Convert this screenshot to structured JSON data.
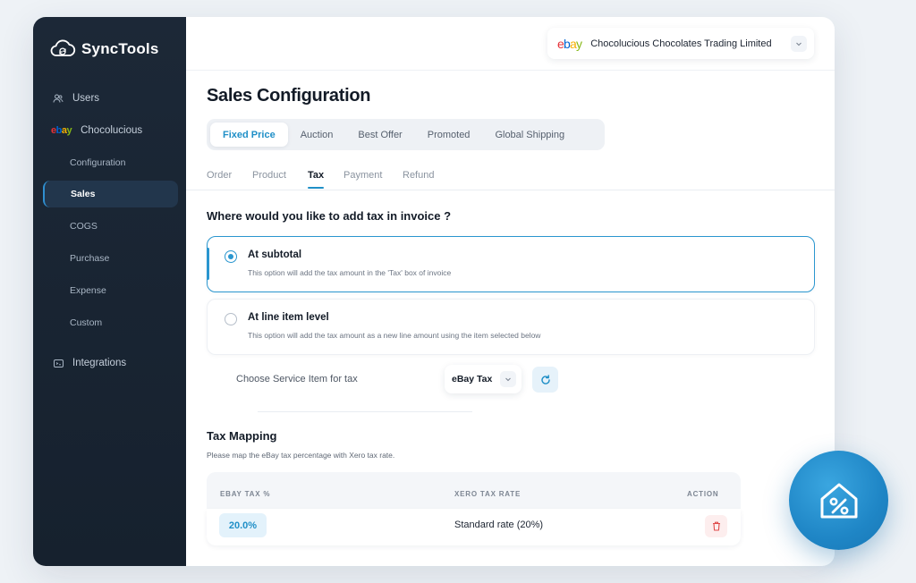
{
  "app": {
    "brand_name": "SyncTools"
  },
  "sidebar": {
    "items": [
      {
        "label": "Users",
        "icon": "users-icon"
      },
      {
        "label": "Chocolucious",
        "icon": "ebay-logo"
      },
      {
        "label": "Configuration"
      },
      {
        "label": "Sales",
        "active": true
      },
      {
        "label": "COGS"
      },
      {
        "label": "Purchase"
      },
      {
        "label": "Expense"
      },
      {
        "label": "Custom"
      },
      {
        "label": "Integrations",
        "icon": "integrations-icon"
      }
    ],
    "ebay_logo": {
      "e": "e",
      "b": "b",
      "a": "a",
      "y": "y"
    }
  },
  "header": {
    "org_name": "Chocolucious Chocolates Trading Limited"
  },
  "page": {
    "title": "Sales Configuration",
    "segments": [
      "Fixed Price",
      "Auction",
      "Best Offer",
      "Promoted",
      "Global Shipping"
    ],
    "active_segment": "Fixed Price",
    "subtabs": [
      "Order",
      "Product",
      "Tax",
      "Payment",
      "Refund"
    ],
    "active_subtab": "Tax"
  },
  "tax": {
    "question": "Where would you like to add tax in invoice ?",
    "options": [
      {
        "title": "At subtotal",
        "desc": "This option will add the tax amount in the 'Tax' box of invoice",
        "selected": true
      },
      {
        "title": "At line item level",
        "desc": "This option will add the tax amount as a new line amount using the item selected below",
        "selected": false
      }
    ],
    "service_item_label": "Choose Service Item for tax",
    "service_item_value": "eBay Tax"
  },
  "tax_mapping": {
    "title": "Tax Mapping",
    "description": "Please map the eBay tax percentage with Xero tax rate.",
    "columns": [
      "EBAY TAX %",
      "XERO TAX RATE",
      "ACTION"
    ],
    "rows": [
      {
        "ebay_tax": "20.0%",
        "xero_rate": "Standard rate (20%)"
      }
    ]
  },
  "colors": {
    "accent": "#1f8fc7",
    "sidebar_bg": "#1c2837",
    "danger": "#e04b4b"
  }
}
